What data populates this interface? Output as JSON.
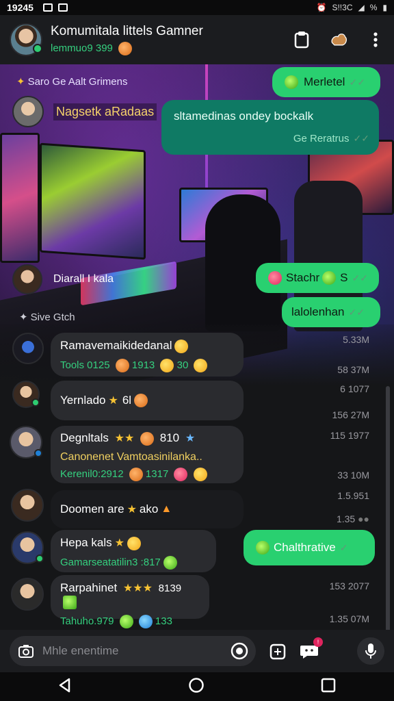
{
  "status_bar": {
    "time": "19245",
    "right_text": "S!!3C",
    "battery": "%"
  },
  "header": {
    "title": "Komumitala littels Gamner",
    "subtitle": "lemmuo9 399",
    "icons": [
      "clipboard-icon",
      "hand-icon",
      "more-vert-icon"
    ]
  },
  "messages": {
    "bg_label_1": "Saro Ge Aalt Grimens",
    "sender_1": "Nagsetk aRadaas",
    "out_1": "Merletel",
    "out_2_line": "sltamedinas ondey bockalk",
    "out_2_meta": "Ge Reratrus",
    "sender_2": "Diarall I kala",
    "out_3": "Stachr",
    "out_3_suffix": "S",
    "out_4": "lalolenhan",
    "divider_label": "Sive Gtch",
    "in_1_text": "Ramavemaikidedanal",
    "in_1_meta": "Tools 0125",
    "in_1_meta_num": "1913",
    "in_1_meta_num2": "30",
    "in_2_text": "Yernlado",
    "in_2_suffix": "6l",
    "in_3_text": "Degnltals",
    "in_3_suffix": "810",
    "in_3_line2": "Canonenet Vamtoasinilanka..",
    "in_3_meta": "Kerenil0:2912",
    "in_3_meta_num": "1317",
    "in_4_text": "Doomen are",
    "in_4_suffix": "ako",
    "in_5_text": "Hepa kals",
    "in_5_meta": "Gamarseatatilin3 :817",
    "out_5": "Chalthrative",
    "in_6_text": "Rarpahinet",
    "in_6_suffix": "8139",
    "in_6_meta": "Tahuho.979",
    "in_6_meta_num": "133",
    "timestamps": [
      "5.33M",
      "58 37M",
      "6 1077",
      "156 27M",
      "115 1977",
      "33 10M",
      "1.5.951",
      "1.35",
      "153 2077",
      "1.35 07M"
    ]
  },
  "input": {
    "placeholder": "Mhle enentime"
  },
  "navbar": {
    "icons": [
      "back-icon",
      "home-icon",
      "recents-icon"
    ]
  }
}
